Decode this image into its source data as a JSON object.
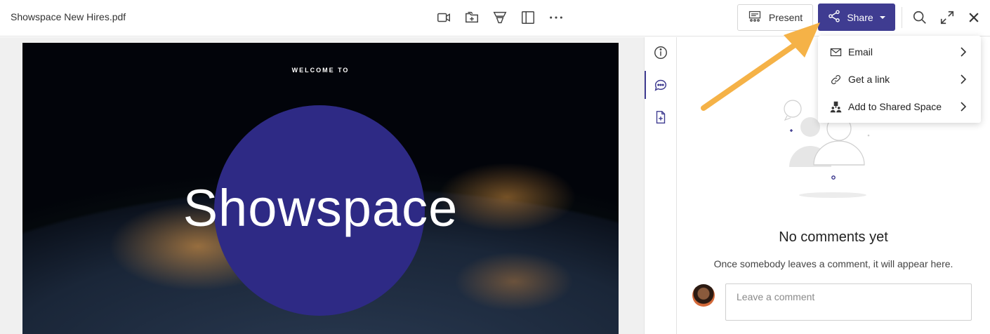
{
  "header": {
    "file_title": "Showspace New Hires.pdf",
    "tools": [
      "video-icon",
      "add-to-folder-icon",
      "funnel-icon",
      "panel-icon",
      "more-icon"
    ],
    "present_label": "Present",
    "share_label": "Share"
  },
  "slide": {
    "welcome": "WELCOME TO",
    "brand": "Showspace",
    "circle_color": "#2e2a85"
  },
  "side_rail": {
    "items": [
      "info-icon",
      "comments-icon",
      "document-add-icon"
    ],
    "active": "comments-icon"
  },
  "comments": {
    "empty_title": "No comments yet",
    "empty_hint": "Once somebody leaves a comment, it will appear here.",
    "input_placeholder": "Leave a comment"
  },
  "share_menu": {
    "items": [
      {
        "icon": "email-icon",
        "label": "Email"
      },
      {
        "icon": "link-icon",
        "label": "Get a link"
      },
      {
        "icon": "shared-space-icon",
        "label": "Add to Shared Space"
      }
    ]
  },
  "colors": {
    "accent": "#3f3c91",
    "arrow": "#f5b247"
  }
}
